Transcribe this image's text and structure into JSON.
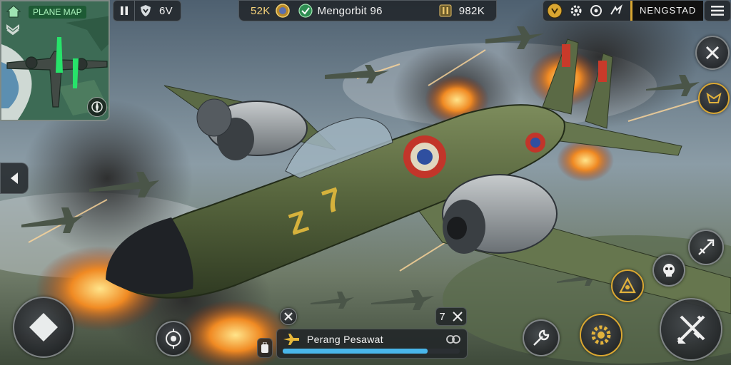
{
  "minimap": {
    "title": "PLANE MAP"
  },
  "top_left": {
    "pause_icon": "pause-icon",
    "shield_icon": "shield-icon",
    "value": "6V"
  },
  "top_center": {
    "gold_amount": "52K",
    "mission_text": "Mengorbit 96",
    "bullets": "982K"
  },
  "top_right": {
    "player_name": "NENGSTAD"
  },
  "bottom": {
    "mission_label": "Perang Pesawat",
    "counter": "7",
    "progress": 0.82
  },
  "colors": {
    "accent_gold": "#d9a631",
    "minimap_green": "#3d6b55",
    "progress_blue": "#49b6ea"
  }
}
